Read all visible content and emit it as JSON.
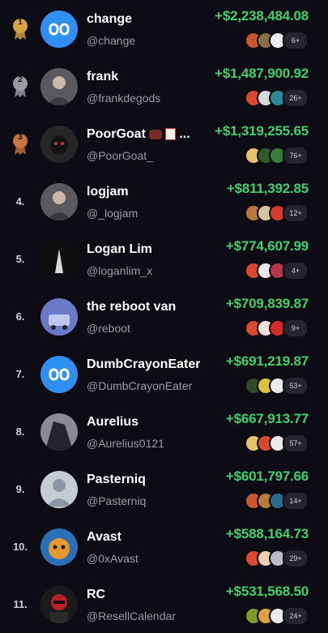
{
  "medal_colors": {
    "gold": "#d9a441",
    "silver": "#9a9aa2",
    "bronze": "#c9733e"
  },
  "accent_green": "#3ed06f",
  "rows": [
    {
      "rank": "1",
      "medal": "gold",
      "name": "change",
      "handle": "@change",
      "profit": "+$2,238,484.08",
      "more": "6+",
      "avatar_icon": "dexscreener-logo",
      "tokens": [
        "#c9572b",
        "#8a6b4a",
        "#ececec"
      ]
    },
    {
      "rank": "2",
      "medal": "silver",
      "name": "frank",
      "handle": "@frankdegods",
      "profit": "+$1,487,900.92",
      "more": "26+",
      "avatar_icon": "person-photo",
      "tokens": [
        "#d9492f",
        "#d8d8d8",
        "#2a8a9a"
      ]
    },
    {
      "rank": "3",
      "medal": "bronze",
      "name": "PoorGoat",
      "name_suffix": " ...",
      "handle": "@PoorGoat_",
      "profit": "+$1,319,255.65",
      "more": "76+",
      "avatar_icon": "goat-photo",
      "tokens": [
        "#e8c36a",
        "#2f5a2a",
        "#3c7a3a"
      ]
    },
    {
      "rank": "4.",
      "name": "logjam",
      "handle": "@_logjam",
      "profit": "+$811,392.85",
      "more": "12+",
      "avatar_icon": "person-photo",
      "tokens": [
        "#b87a3a",
        "#d6c79a",
        "#d63a2a"
      ]
    },
    {
      "rank": "5.",
      "name": "Logan Lim",
      "handle": "@loganlim_x",
      "profit": "+$774,607.99",
      "more": "4+",
      "avatar_icon": "silhouette-photo",
      "tokens": [
        "#d9492f",
        "#eaeaea",
        "#b8324a"
      ]
    },
    {
      "rank": "6.",
      "name": "the reboot van",
      "handle": "@reboot",
      "profit": "+$709,839.87",
      "more": "9+",
      "avatar_icon": "van-photo",
      "tokens": [
        "#d9492f",
        "#f0e0e0",
        "#d42a2a"
      ]
    },
    {
      "rank": "7.",
      "name": "DumbCrayonEater",
      "handle": "@DumbCrayonEater",
      "profit": "+$691,219.87",
      "more": "53+",
      "avatar_icon": "dexscreener-logo",
      "tokens": [
        "#2f4a2a",
        "#d8c33a",
        "#eaeaea"
      ]
    },
    {
      "rank": "8.",
      "name": "Aurelius",
      "handle": "@Aurelius0121",
      "profit": "+$667,913.77",
      "more": "57+",
      "avatar_icon": "anime-photo",
      "tokens": [
        "#e8c36a",
        "#d9492f",
        "#eaeaea"
      ]
    },
    {
      "rank": "9.",
      "name": "Pasterniq",
      "handle": "@Pasterniq",
      "profit": "+$601,797.66",
      "more": "14+",
      "avatar_icon": "default-user",
      "tokens": [
        "#c9572b",
        "#b87a3a",
        "#2a6a8a"
      ]
    },
    {
      "rank": "10.",
      "name": "Avast",
      "handle": "@0xAvast",
      "profit": "+$588,164.73",
      "more": "29+",
      "avatar_icon": "cat-photo",
      "tokens": [
        "#d9492f",
        "#e8d0b0",
        "#bcbcc4"
      ]
    },
    {
      "rank": "11.",
      "name": "RC",
      "handle": "@ResellCalendar",
      "profit": "+$531,568.50",
      "more": "24+",
      "avatar_icon": "masked-photo",
      "tokens": [
        "#7a9a2a",
        "#e0a040",
        "#eaeaea"
      ]
    }
  ]
}
